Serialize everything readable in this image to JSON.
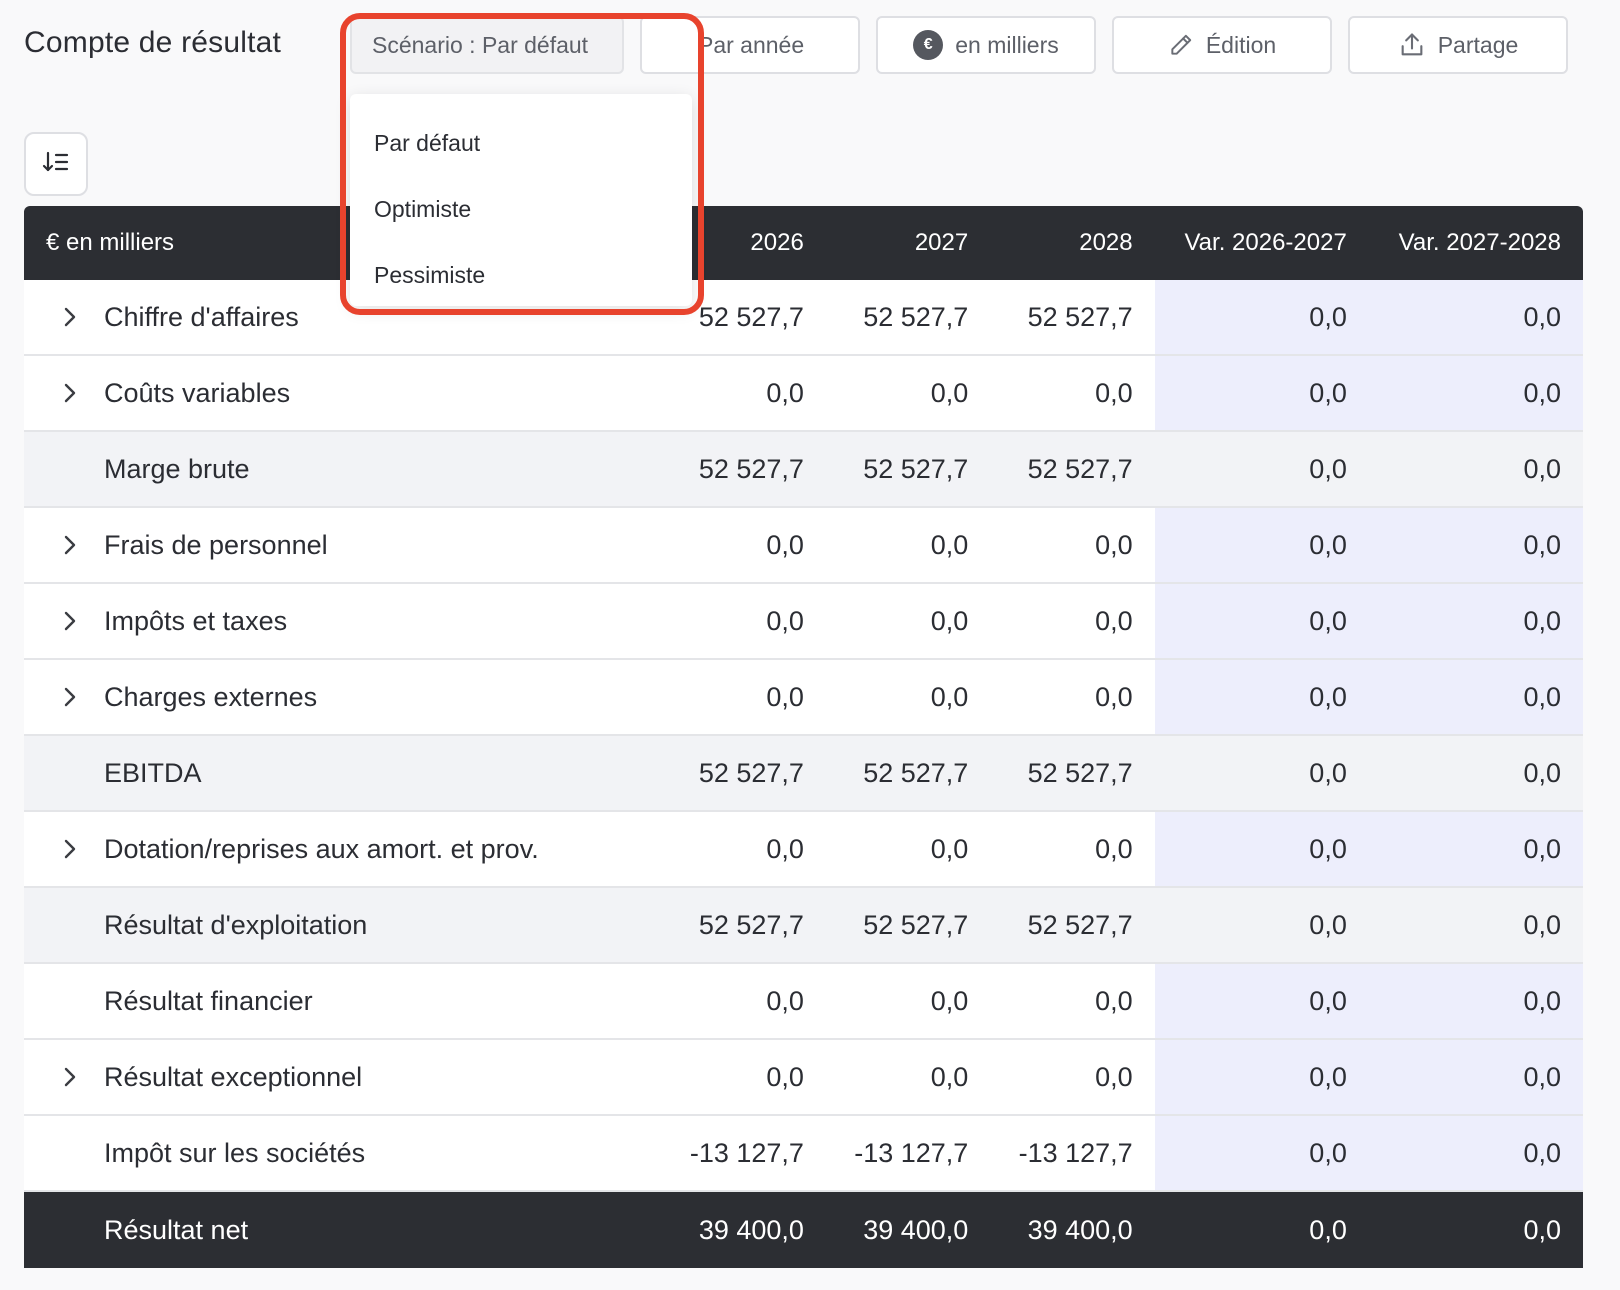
{
  "page": {
    "title": "Compte de résultat"
  },
  "toolbar": {
    "scenario_label": "Scénario : Par défaut",
    "period_label": "Par année",
    "units_label": "en milliers",
    "units_symbol": "€",
    "edit_label": "Édition",
    "share_label": "Partage"
  },
  "scenario_menu": {
    "options": [
      "Par défaut",
      "Optimiste",
      "Pessimiste"
    ]
  },
  "table": {
    "header": {
      "label": "€ en milliers",
      "columns": [
        "2026",
        "2027",
        "2028",
        "Var. 2026-2027",
        "Var. 2027-2028"
      ]
    },
    "rows": [
      {
        "label": "Chiffre d'affaires",
        "values": [
          "52 527,7",
          "52 527,7",
          "52 527,7",
          "0,0",
          "0,0"
        ]
      },
      {
        "label": "Coûts variables",
        "values": [
          "0,0",
          "0,0",
          "0,0",
          "0,0",
          "0,0"
        ]
      },
      {
        "label": "Marge brute",
        "values": [
          "52 527,7",
          "52 527,7",
          "52 527,7",
          "0,0",
          "0,0"
        ]
      },
      {
        "label": "Frais de personnel",
        "values": [
          "0,0",
          "0,0",
          "0,0",
          "0,0",
          "0,0"
        ]
      },
      {
        "label": "Impôts et taxes",
        "values": [
          "0,0",
          "0,0",
          "0,0",
          "0,0",
          "0,0"
        ]
      },
      {
        "label": "Charges externes",
        "values": [
          "0,0",
          "0,0",
          "0,0",
          "0,0",
          "0,0"
        ]
      },
      {
        "label": "EBITDA",
        "values": [
          "52 527,7",
          "52 527,7",
          "52 527,7",
          "0,0",
          "0,0"
        ]
      },
      {
        "label": "Dotation/reprises aux amort. et prov.",
        "values": [
          "0,0",
          "0,0",
          "0,0",
          "0,0",
          "0,0"
        ]
      },
      {
        "label": "Résultat d'exploitation",
        "values": [
          "52 527,7",
          "52 527,7",
          "52 527,7",
          "0,0",
          "0,0"
        ]
      },
      {
        "label": "Résultat financier",
        "values": [
          "0,0",
          "0,0",
          "0,0",
          "0,0",
          "0,0"
        ]
      },
      {
        "label": "Résultat exceptionnel",
        "values": [
          "0,0",
          "0,0",
          "0,0",
          "0,0",
          "0,0"
        ]
      },
      {
        "label": "Impôt sur les sociétés",
        "values": [
          "-13 127,7",
          "-13 127,7",
          "-13 127,7",
          "0,0",
          "0,0"
        ]
      },
      {
        "label": "Résultat net",
        "values": [
          "39 400,0",
          "39 400,0",
          "39 400,0",
          "0,0",
          "0,0"
        ]
      }
    ]
  },
  "colors": {
    "highlight": "#e8432d",
    "header_bg": "#2c2e33",
    "variance_bg": "#edeefc",
    "subtotal_bg": "#f2f3f6"
  }
}
